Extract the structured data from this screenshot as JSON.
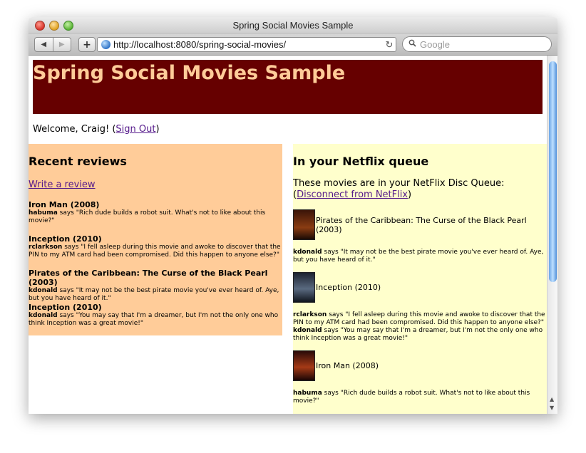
{
  "window": {
    "title": "Spring Social Movies Sample"
  },
  "toolbar": {
    "back_label": "◀",
    "forward_label": "▶",
    "add_label": "+",
    "url": "http://localhost:8080/spring-social-movies/",
    "reload_label": "↻",
    "search_placeholder": "Google"
  },
  "page": {
    "title": "Spring Social Movies Sample",
    "welcome_prefix": "Welcome, Craig! (",
    "sign_out": "Sign Out",
    "welcome_suffix": ")"
  },
  "reviews": {
    "heading": "Recent reviews",
    "write_link": "Write a review",
    "says": "says",
    "items": [
      {
        "movie": "Iron Man (2008)",
        "user": "habuma",
        "text": "\"Rich dude builds a robot suit. What's not to like about this movie?\""
      },
      {
        "movie": "Inception (2010)",
        "user": "rclarkson",
        "text": "\"I fell asleep during this movie and awoke to discover that the PIN to my ATM card had been compromised. Did this happen to anyone else?\""
      },
      {
        "movie": "Pirates of the Caribbean: The Curse of the Black Pearl (2003)",
        "user": "kdonald",
        "text": "\"It may not be the best pirate movie you've ever heard of. Aye, but you have heard of it.\""
      },
      {
        "movie": "Inception (2010)",
        "user": "kdonald",
        "text": "\"You may say that I'm a dreamer, but I'm not the only one who think Inception was a great movie!\""
      }
    ]
  },
  "netflix": {
    "heading": "In your Netflix queue",
    "intro": "These movies are in your NetFlix Disc Queue:",
    "disconnect_prefix": "(",
    "disconnect": "Disconnect from NetFlix",
    "disconnect_suffix": ")",
    "says": "says",
    "movies": [
      {
        "title": "Pirates of the Caribbean: The Curse of the Black Pearl (2003)",
        "comments": [
          {
            "user": "kdonald",
            "text": "\"It may not be the best pirate movie you've ever heard of. Aye, but you have heard of it.\""
          }
        ]
      },
      {
        "title": "Inception (2010)",
        "comments": [
          {
            "user": "rclarkson",
            "text": "\"I fell asleep during this movie and awoke to discover that the PIN to my ATM card had been compromised. Did this happen to anyone else?\""
          },
          {
            "user": "kdonald",
            "text": "\"You may say that I'm a dreamer, but I'm not the only one who think Inception was a great movie!\""
          }
        ]
      },
      {
        "title": "Iron Man (2008)",
        "comments": [
          {
            "user": "habuma",
            "text": "\"Rich dude builds a robot suit. What's not to like about this movie?\""
          }
        ]
      }
    ]
  },
  "colors": {
    "header_bg": "#660000",
    "header_text": "#ffcc99",
    "reviews_bg": "#ffcc99",
    "netflix_bg": "#ffffcc",
    "link": "#551a8b"
  }
}
